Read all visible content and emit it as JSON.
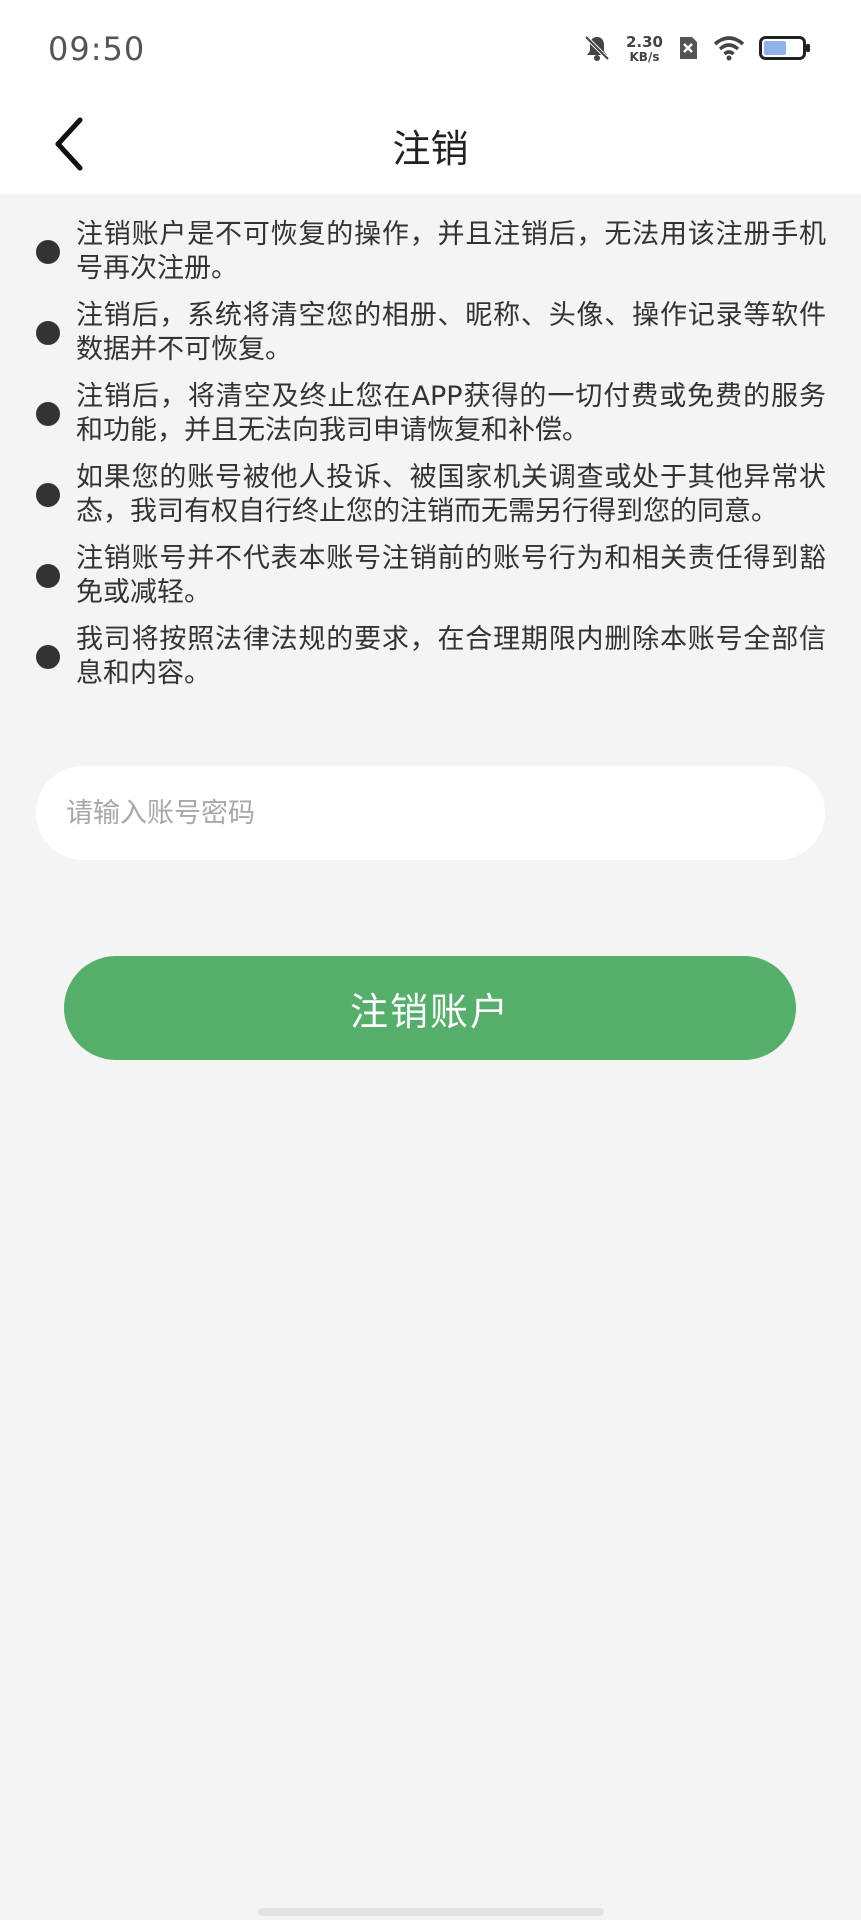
{
  "status_bar": {
    "time": "09:50",
    "net_speed_value": "2.30",
    "net_speed_unit": "KB/s",
    "icons": [
      "bell-muted-icon",
      "sim-off-icon",
      "wifi-icon",
      "battery-icon"
    ]
  },
  "nav": {
    "title": "注销",
    "back_icon": "chevron-left-icon"
  },
  "notices": [
    "注销账户是不可恢复的操作，并且注销后，无法用该注册手机号再次注册。",
    "注销后，系统将清空您的相册、昵称、头像、操作记录等软件数据并不可恢复。",
    "注销后，将清空及终止您在APP获得的一切付费或免费的服务和功能，并且无法向我司申请恢复和补偿。",
    "如果您的账号被他人投诉、被国家机关调查或处于其他异常状态，我司有权自行终止您的注销而无需另行得到您的同意。",
    "注销账号并不代表本账号注销前的账号行为和相关责任得到豁免或减轻。",
    "我司将按照法律法规的要求，在合理期限内删除本账号全部信息和内容。"
  ],
  "password": {
    "value": "",
    "placeholder": "请输入账号密码"
  },
  "deactivate_button": {
    "label": "注销账户"
  },
  "colors": {
    "accent": "#55af6b",
    "background": "#f4f4f4",
    "text": "#333333",
    "placeholder": "#a8a8a8"
  }
}
